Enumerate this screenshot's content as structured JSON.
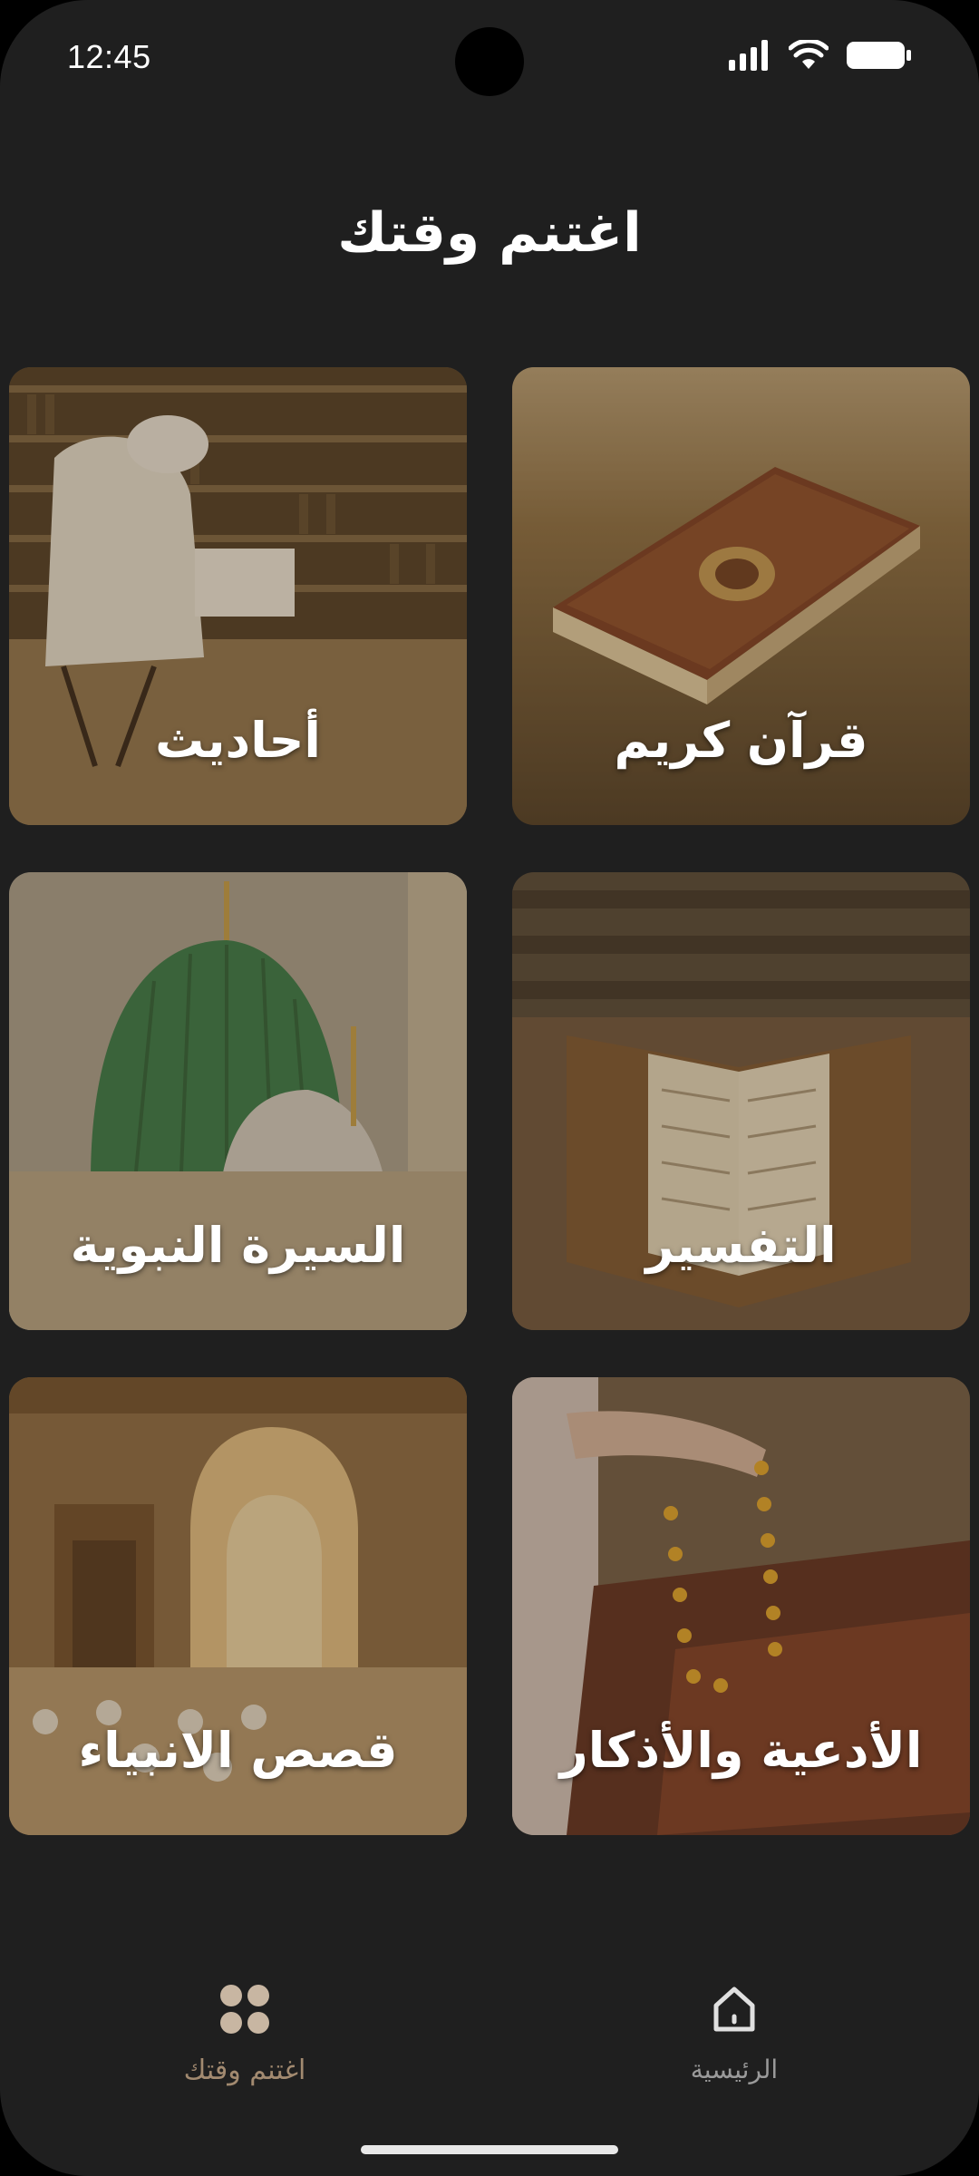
{
  "status_bar": {
    "time": "12:45",
    "icons": [
      "signal-icon",
      "wifi-icon",
      "battery-icon"
    ]
  },
  "page": {
    "title": "اغتنم وقتك"
  },
  "categories": [
    {
      "label": "قرآن كريم",
      "image": "quran-book-image"
    },
    {
      "label": "أحاديث",
      "image": "man-reading-library-image"
    },
    {
      "label": "التفسير",
      "image": "open-quran-stand-image"
    },
    {
      "label": "السيرة النبوية",
      "image": "green-dome-mosque-image"
    },
    {
      "label": "الأدعية والأذكار",
      "image": "prayer-beads-image"
    },
    {
      "label": "قصص الانبياء",
      "image": "mosque-interior-image"
    }
  ],
  "bottom_nav": {
    "home_label": "الرئيسية",
    "time_label": "اغتنم وقتك",
    "active": "time",
    "colors": {
      "active": "#a28a70",
      "inactive": "#9a9a9a"
    }
  },
  "colors": {
    "background": "#1f1f1f",
    "title": "#ffffff",
    "card_overlay": "#503a1c"
  }
}
